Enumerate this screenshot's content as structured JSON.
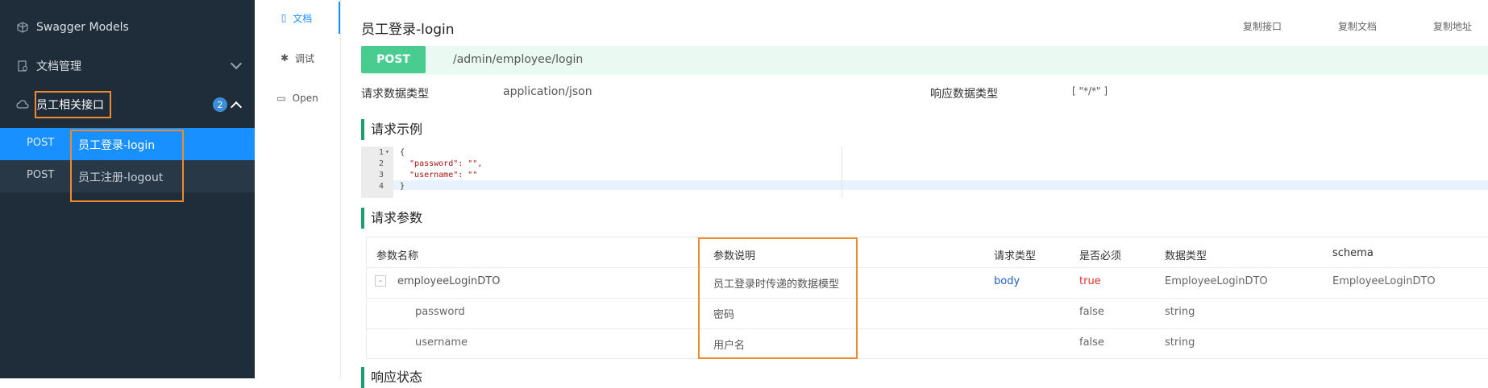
{
  "sidebar": {
    "models_label": "Swagger Models",
    "docs_label": "文档管理",
    "group_label": "员工相关接口",
    "group_count": "2",
    "operations": [
      {
        "method": "POST",
        "name": "员工登录-login"
      },
      {
        "method": "POST",
        "name": "员工注册-logout"
      }
    ]
  },
  "tabs": [
    {
      "label": "文档"
    },
    {
      "label": "调试"
    },
    {
      "label": "Open"
    }
  ],
  "main": {
    "title": "员工登录-login",
    "copy_api": "复制接口",
    "copy_doc": "复制文档",
    "copy_url": "复制地址",
    "method": "POST",
    "path": "/admin/employee/login",
    "req_type_label": "请求数据类型",
    "req_type_value": "application/json",
    "resp_type_label": "响应数据类型",
    "resp_type_value": "[ \"*/*\" ]",
    "section_example": "请求示例",
    "section_params": "请求参数",
    "section_status": "响应状态",
    "code_lines": [
      "1",
      "2",
      "3",
      "4"
    ],
    "code": {
      "l1": "{",
      "l2": "  \"password\": \"\",",
      "l3": "  \"username\": \"\"",
      "l4": "}"
    },
    "table": {
      "headers": [
        "参数名称",
        "参数说明",
        "请求类型",
        "是否必须",
        "数据类型",
        "schema"
      ],
      "rows": [
        {
          "name": "employeeLoginDTO",
          "desc": "员工登录时传递的数据模型",
          "in": "body",
          "required": "true",
          "type": "EmployeeLoginDTO",
          "schema": "EmployeeLoginDTO"
        },
        {
          "name": "password",
          "desc": "密码",
          "in": "",
          "required": "false",
          "type": "string",
          "schema": ""
        },
        {
          "name": "username",
          "desc": "用户名",
          "in": "",
          "required": "false",
          "type": "string",
          "schema": ""
        }
      ]
    }
  },
  "colors": {
    "sidebar_bg": "#1f2d3a",
    "active": "#1890ff",
    "post": "#49cc90",
    "highlight": "#f08a2a",
    "required_true": "#e0302c",
    "body_blue": "#1e5fbf"
  }
}
